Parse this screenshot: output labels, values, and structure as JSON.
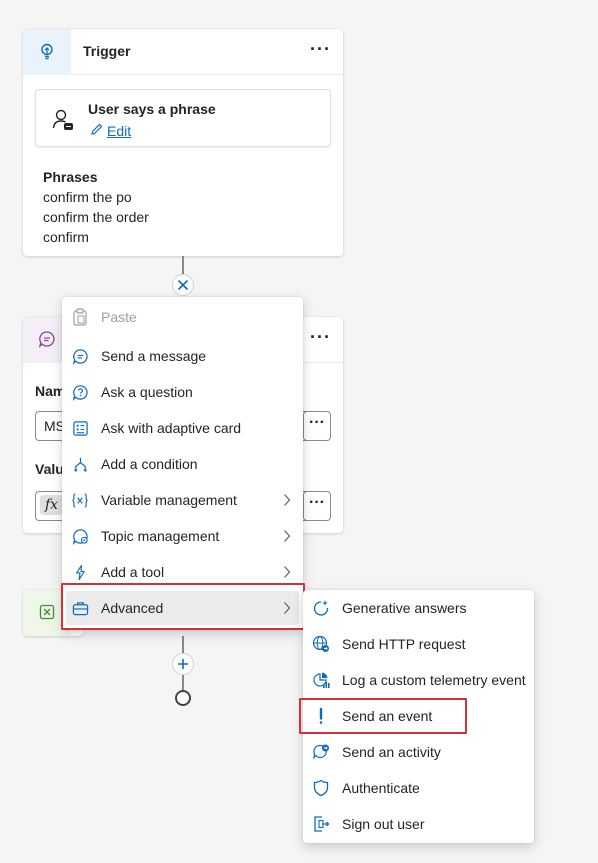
{
  "trigger": {
    "title": "Trigger",
    "more": "···",
    "inner_title": "User says a phrase",
    "edit": "Edit",
    "phrases_label": "Phrases",
    "phrases": [
      "confirm the po",
      "confirm the order",
      "confirm"
    ]
  },
  "message_card": {
    "more": "···",
    "name_label": "Nam",
    "name_value": "MS",
    "value_label": "Valu",
    "fx": "fx",
    "dots": "···"
  },
  "menu": {
    "items": [
      {
        "label": "Paste",
        "icon": "paste-icon",
        "disabled": true
      },
      {
        "label": "Send a message",
        "icon": "message-icon"
      },
      {
        "label": "Ask a question",
        "icon": "question-icon"
      },
      {
        "label": "Ask with adaptive card",
        "icon": "adaptive-card-icon"
      },
      {
        "label": "Add a condition",
        "icon": "condition-icon"
      },
      {
        "label": "Variable management",
        "icon": "variable-icon",
        "submenu": true
      },
      {
        "label": "Topic management",
        "icon": "topic-icon",
        "submenu": true
      },
      {
        "label": "Add a tool",
        "icon": "tool-icon",
        "submenu": true
      },
      {
        "label": "Advanced",
        "icon": "briefcase-icon",
        "submenu": true,
        "active": true
      }
    ]
  },
  "submenu": {
    "items": [
      {
        "label": "Generative answers",
        "icon": "generative-answers-icon"
      },
      {
        "label": "Send HTTP request",
        "icon": "http-request-icon"
      },
      {
        "label": "Log a custom telemetry event",
        "icon": "telemetry-icon"
      },
      {
        "label": "Send an event",
        "icon": "event-icon",
        "highlighted": true
      },
      {
        "label": "Send an activity",
        "icon": "activity-icon"
      },
      {
        "label": "Authenticate",
        "icon": "shield-icon"
      },
      {
        "label": "Sign out user",
        "icon": "sign-out-icon"
      }
    ]
  },
  "colors": {
    "accent": "#0f6cbd",
    "highlight": "#d13438",
    "trigger_header_bg": "#e8f3fc",
    "message_header_bg": "#f4eef7",
    "end_node_bg": "#eef7e9"
  }
}
